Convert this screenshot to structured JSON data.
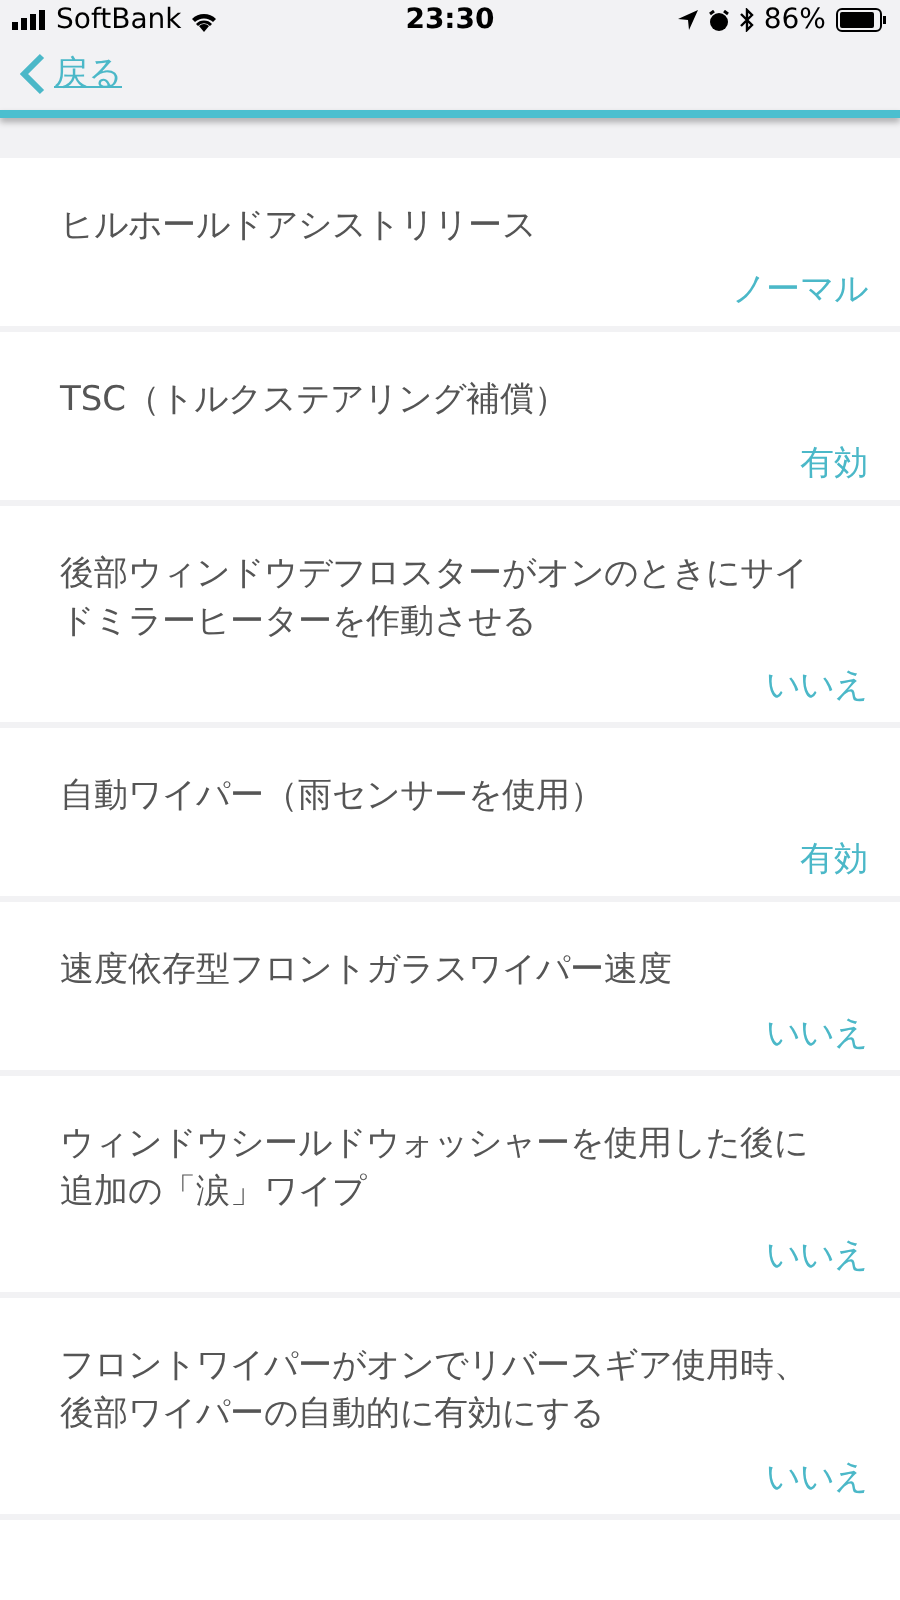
{
  "status_bar": {
    "carrier": "SoftBank",
    "time": "23:30",
    "battery": "86%"
  },
  "nav": {
    "back": "戻る"
  },
  "settings": [
    {
      "label": "ヒルホールドアシストリリース",
      "value": "ノーマル"
    },
    {
      "label": "TSC（トルクステアリング補償）",
      "value": "有効"
    },
    {
      "label": "後部ウィンドウデフロスターがオンのときにサイドミラーヒーターを作動させる",
      "value": "いいえ"
    },
    {
      "label": "自動ワイパー（雨センサーを使用）",
      "value": "有効"
    },
    {
      "label": "速度依存型フロントガラスワイパー速度",
      "value": "いいえ"
    },
    {
      "label": "ウィンドウシールドウォッシャーを使用した後に追加の「涙」ワイプ",
      "value": "いいえ"
    },
    {
      "label": "フロントワイパーがオンでリバースギア使用時、後部ワイパーの自動的に有効にする",
      "value": "いいえ"
    }
  ]
}
